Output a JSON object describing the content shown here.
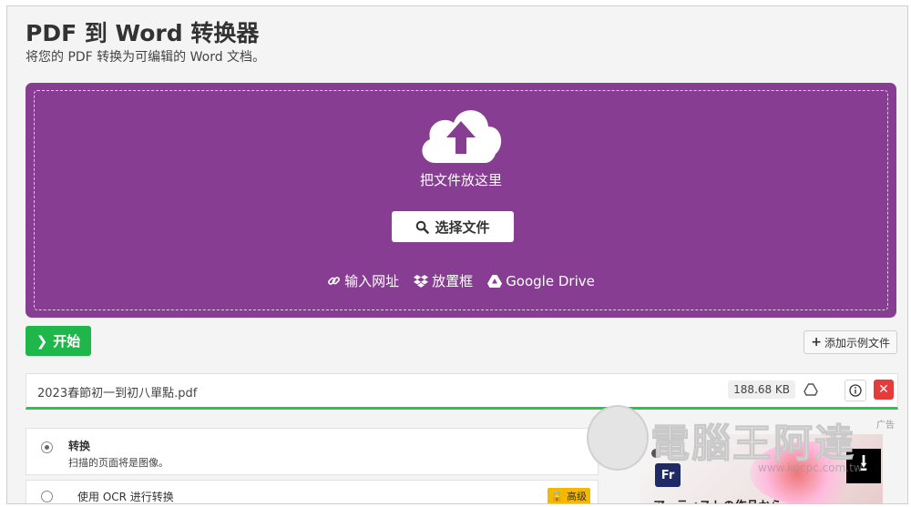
{
  "header": {
    "title": "PDF 到 Word 转换器",
    "subtitle": "将您的 PDF 转换为可编辑的 Word 文档。"
  },
  "dropzone": {
    "drop_text": "把文件放这里",
    "choose_label": "选择文件",
    "links": {
      "url": "输入网址",
      "dropbox": "放置框",
      "gdrive": "Google Drive"
    },
    "color": "#873d92"
  },
  "actions": {
    "start_label": "开始",
    "sample_label": "添加示例文件"
  },
  "file": {
    "name": "2023春節初一到初八單點.pdf",
    "size": "188.68 KB",
    "progress": 1.0
  },
  "ad_label": "广告",
  "options": [
    {
      "title": "转换",
      "desc": "扫描的页面将是图像。",
      "selected": true
    },
    {
      "title": "使用 OCR 进行转换",
      "badge": "高级",
      "selected": false
    }
  ],
  "ad": {
    "logo": "Fr",
    "text": "アーティストの作品から"
  },
  "watermark": {
    "text": "電腦王阿達",
    "url": "www.kocpc.com.tw"
  },
  "colors": {
    "accent_green": "#20b74a",
    "delete_red": "#e63b3b",
    "premium_yellow": "#f5b800"
  }
}
